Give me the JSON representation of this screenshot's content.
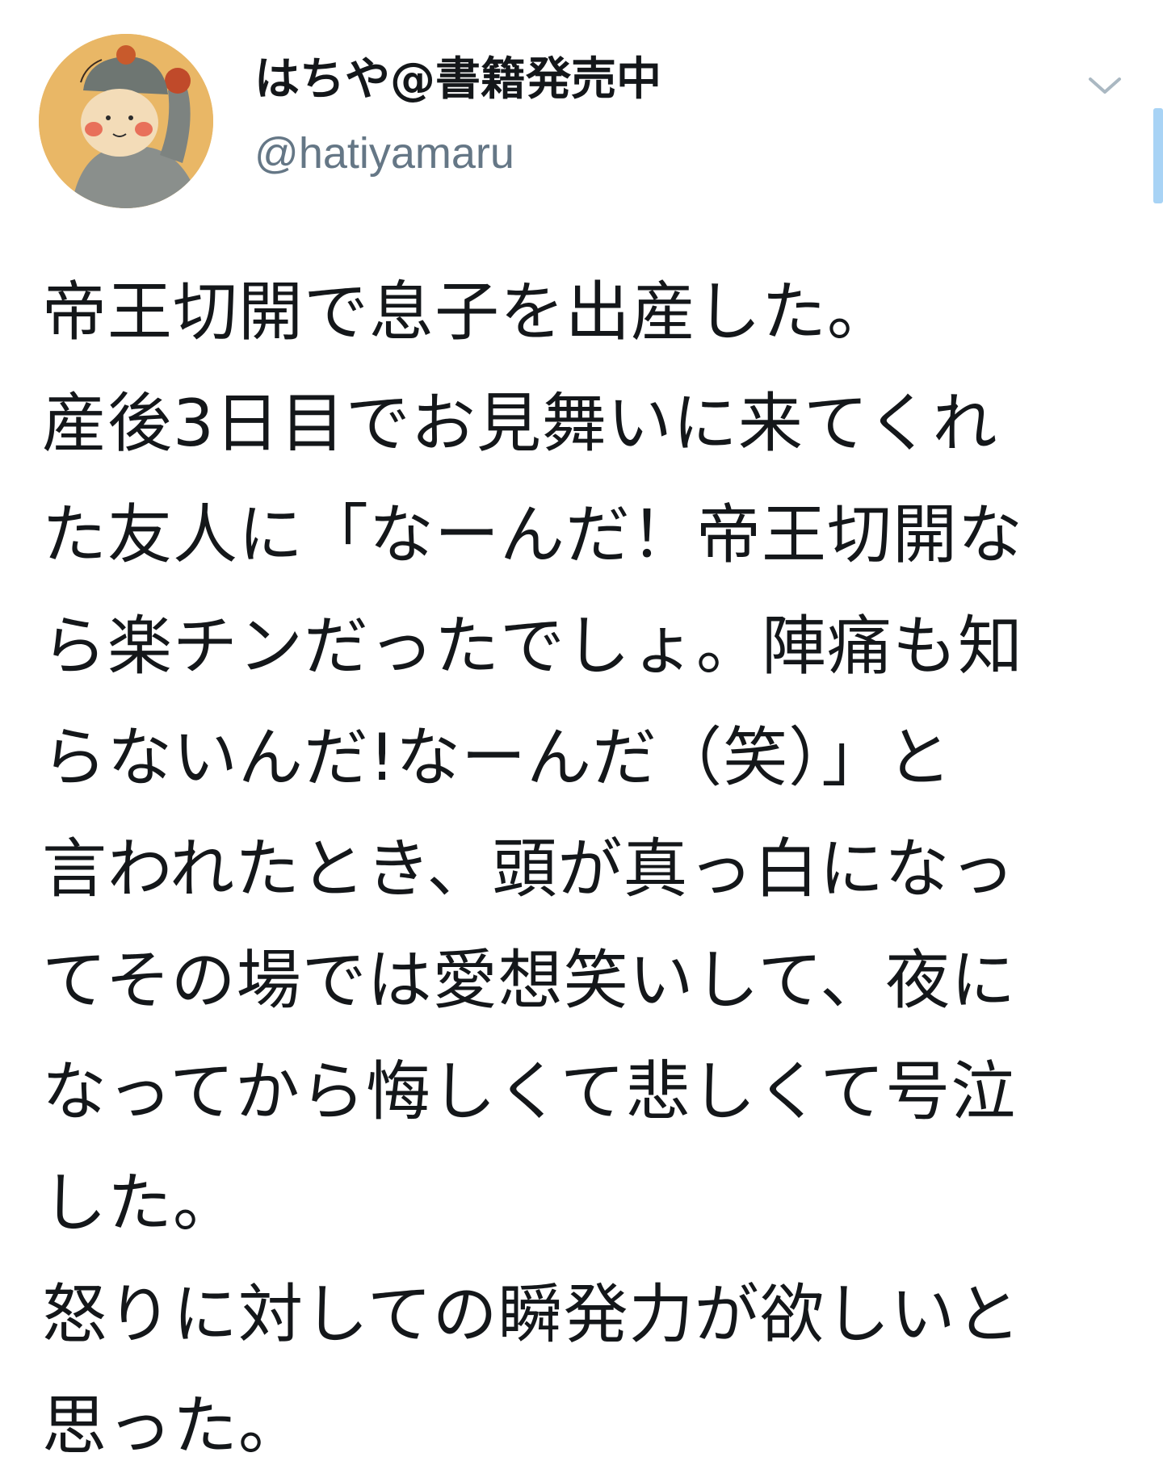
{
  "tweet": {
    "author": {
      "display_name": "はちや@書籍発売中",
      "handle": "@hatiyamaru",
      "avatar_icon": "illustrated-avatar"
    },
    "menu_icon": "chevron-down-icon",
    "lines": [
      "帝王切開で息子を出産した。",
      "産後3日目でお見舞いに来てくれ",
      "た友人に「なーんだ！帝王切開な",
      "ら楽チンだったでしょ。陣痛も知",
      "らないんだ!なーんだ（笑）」と",
      "言われたとき、頭が真っ白になっ",
      "てその場では愛想笑いして、夜に",
      "なってから悔しくて悲しくて号泣",
      "した。",
      "怒りに対しての瞬発力が欲しいと",
      "思った。"
    ]
  },
  "colors": {
    "text": "#14171a",
    "handle": "#657786",
    "caret": "#aab8c2",
    "scroll_indicator": "#a8d3f5",
    "avatar_background": "#e9b766"
  }
}
